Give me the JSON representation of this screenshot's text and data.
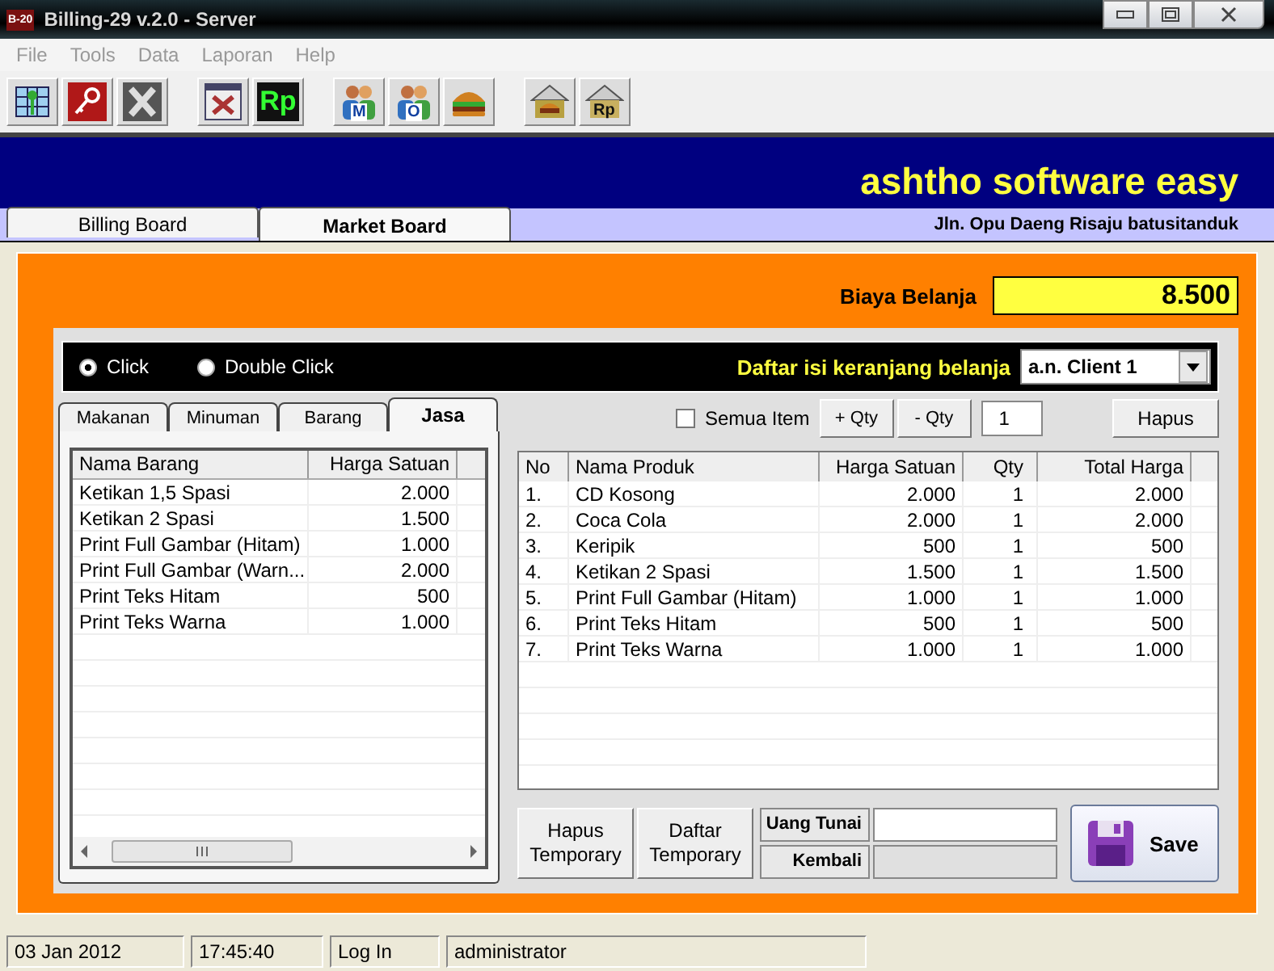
{
  "window": {
    "title": "Billing-29 v.2.0 - Server",
    "app_icon_label": "B-20"
  },
  "menu": [
    "File",
    "Tools",
    "Data",
    "Laporan",
    "Help"
  ],
  "toolbar": [
    {
      "kind": "table-key"
    },
    {
      "kind": "key"
    },
    {
      "kind": "cross"
    },
    {
      "kind": "gap"
    },
    {
      "kind": "tools"
    },
    {
      "kind": "money",
      "label": "Rp"
    },
    {
      "kind": "gap"
    },
    {
      "kind": "users",
      "label": "M"
    },
    {
      "kind": "users",
      "label": "O"
    },
    {
      "kind": "burger"
    },
    {
      "kind": "gap"
    },
    {
      "kind": "house-burger"
    },
    {
      "kind": "house-money",
      "label": "Rp"
    }
  ],
  "header": {
    "brand": "ashtho software easy",
    "address": "Jln. Opu Daeng Risaju batusitanduk"
  },
  "tabs": [
    {
      "label": "Billing Board",
      "selected": false
    },
    {
      "label": "Market Board",
      "selected": true
    }
  ],
  "total": {
    "label": "Biaya Belanja",
    "value": "8.500"
  },
  "click_mode": [
    {
      "label": "Click",
      "selected": true
    },
    {
      "label": "Double Click",
      "selected": false
    }
  ],
  "cart": {
    "label": "Daftar isi keranjang belanja",
    "client": "a.n. Client 1"
  },
  "categories": [
    {
      "label": "Makanan",
      "selected": false
    },
    {
      "label": "Minuman",
      "selected": false
    },
    {
      "label": "Barang",
      "selected": false
    },
    {
      "label": "Jasa",
      "selected": true
    }
  ],
  "catalog": {
    "columns": [
      "Nama Barang",
      "Harga Satuan"
    ],
    "rows": [
      [
        "Ketikan 1,5 Spasi",
        "2.000"
      ],
      [
        "Ketikan 2 Spasi",
        "1.500"
      ],
      [
        "Print Full Gambar (Hitam)",
        "1.000"
      ],
      [
        "Print Full Gambar (Warn...",
        "2.000"
      ],
      [
        "Print Teks Hitam",
        "500"
      ],
      [
        "Print Teks Warna",
        "1.000"
      ]
    ]
  },
  "cart_tools": {
    "all_items": {
      "label": "Semua Item",
      "checked": false
    },
    "plus": "+ Qty",
    "minus": "- Qty",
    "qty": "1",
    "delete": "Hapus"
  },
  "cart_table": {
    "columns": [
      "No",
      "Nama Produk",
      "Harga Satuan",
      "Qty",
      "Total Harga"
    ],
    "rows": [
      [
        "1.",
        "CD Kosong",
        "2.000",
        "1",
        "2.000"
      ],
      [
        "2.",
        "Coca Cola",
        "2.000",
        "1",
        "2.000"
      ],
      [
        "3.",
        "Keripik",
        "500",
        "1",
        "500"
      ],
      [
        "4.",
        "Ketikan 2 Spasi",
        "1.500",
        "1",
        "1.500"
      ],
      [
        "5.",
        "Print Full Gambar (Hitam)",
        "1.000",
        "1",
        "1.000"
      ],
      [
        "6.",
        "Print Teks Hitam",
        "500",
        "1",
        "500"
      ],
      [
        "7.",
        "Print Teks Warna",
        "1.000",
        "1",
        "1.000"
      ]
    ]
  },
  "bottom": {
    "clear_temp": [
      "Hapus",
      "Temporary"
    ],
    "list_temp": [
      "Daftar",
      "Temporary"
    ],
    "cash_label": "Uang Tunai",
    "change_label": "Kembali",
    "save": "Save"
  },
  "status_bar": [
    "03 Jan 2012",
    "17:45:40",
    "Log In",
    "administrator"
  ]
}
